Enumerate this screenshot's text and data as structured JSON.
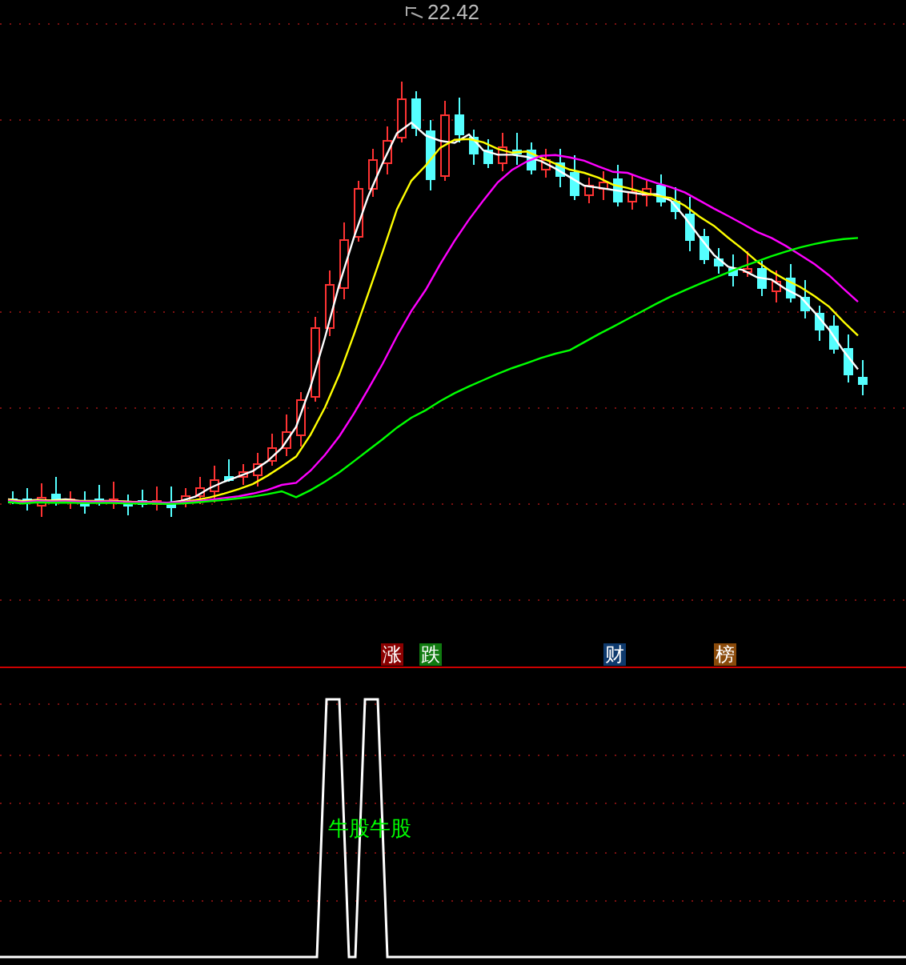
{
  "price_chart": {
    "high_label": "22.42"
  },
  "event_badges": [
    {
      "text": "涨",
      "color": "#8b0000"
    },
    {
      "text": "跌",
      "color": "#107a10"
    },
    {
      "text": "财",
      "color": "#0e3a6e"
    },
    {
      "text": "榜",
      "color": "#8a4a0a"
    }
  ],
  "indicator_panel": {
    "signal_label": "牛股牛股"
  }
}
